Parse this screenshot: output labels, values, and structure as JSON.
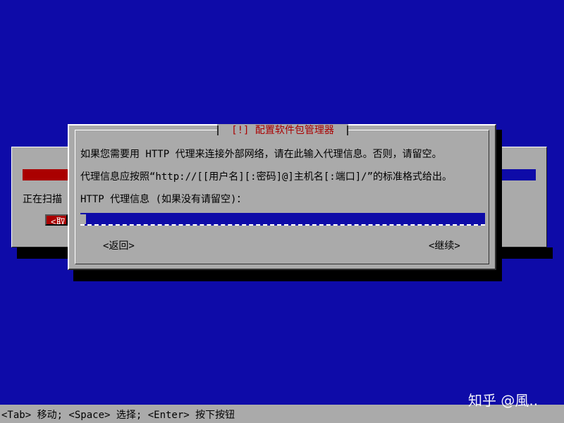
{
  "background_dialog": {
    "status_text": "正在扫描",
    "cancel_label": "<取"
  },
  "dialog": {
    "title": "[!] 配置软件包管理器",
    "line1": "如果您需要用 HTTP 代理来连接外部网络，请在此输入代理信息。否则，请留空。",
    "line2": "代理信息应按照“http://[[用户名][:密码]@]主机名[:端口]/”的标准格式给出。",
    "prompt": "HTTP 代理信息 (如果没有请留空)：",
    "proxy_input": {
      "value": "",
      "placeholder": ""
    },
    "back_label": "<返回>",
    "continue_label": "<继续>"
  },
  "help_bar": {
    "text": "<Tab> 移动; <Space> 选择; <Enter> 按下按钮"
  },
  "watermark": {
    "text": "知乎 @風.."
  },
  "colors": {
    "background": "#0e0ba8",
    "dialog": "#aaaaaa",
    "title": "#aa0000",
    "input": "#0e0ba8"
  }
}
